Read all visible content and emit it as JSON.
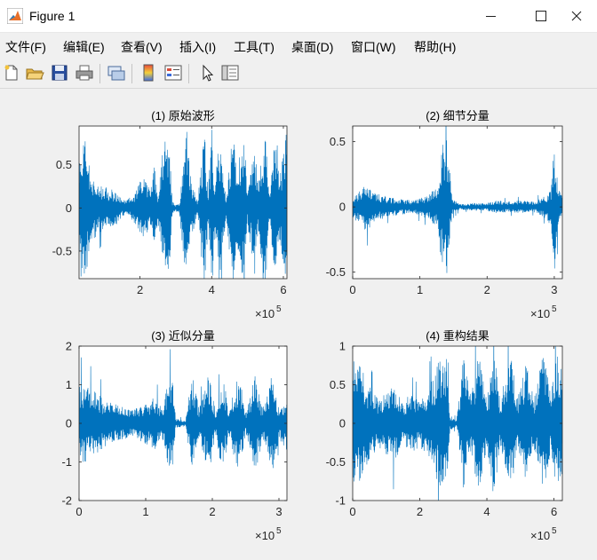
{
  "window": {
    "title": "Figure 1",
    "minimize_glyph": "—",
    "maximize_glyph": "☐",
    "close_glyph": "✕"
  },
  "menu": [
    {
      "label": "文件(F)"
    },
    {
      "label": "编辑(E)"
    },
    {
      "label": "查看(V)"
    },
    {
      "label": "插入(I)"
    },
    {
      "label": "工具(T)"
    },
    {
      "label": "桌面(D)"
    },
    {
      "label": "窗口(W)"
    },
    {
      "label": "帮助(H)"
    }
  ],
  "toolbar": {
    "icons": [
      "new-figure-icon",
      "open-file-icon",
      "save-icon",
      "print-icon",
      "link-plot-icon",
      "insert-colorbar-icon",
      "insert-legend-icon",
      "edit-plot-pointer-icon",
      "property-inspector-icon"
    ]
  },
  "colors": {
    "line": "#0072bd",
    "axes_bg": "#ffffff",
    "figure_bg": "#f0f0f0"
  },
  "chart_data": [
    {
      "type": "line",
      "title": "(1) 原始波形",
      "xlim": [
        30000,
        610000
      ],
      "ylim": [
        -0.82,
        0.95
      ],
      "xticks": [
        {
          "v": 200000,
          "label": "2"
        },
        {
          "v": 400000,
          "label": "4"
        },
        {
          "v": 600000,
          "label": "6"
        }
      ],
      "yticks": [
        {
          "v": 0.5,
          "label": "0.5"
        },
        {
          "v": 0,
          "label": "0"
        },
        {
          "v": -0.5,
          "label": "-0.5"
        }
      ],
      "x_exponent": "×10",
      "exp_power": "5",
      "envelope": [
        [
          30000,
          0.82
        ],
        [
          50000,
          0.78
        ],
        [
          60000,
          0.45
        ],
        [
          80000,
          0.32
        ],
        [
          100000,
          0.25
        ],
        [
          120000,
          0.22
        ],
        [
          140000,
          0.18
        ],
        [
          150000,
          0.1
        ],
        [
          160000,
          0.08
        ],
        [
          170000,
          0.12
        ],
        [
          180000,
          0.15
        ],
        [
          200000,
          0.3
        ],
        [
          210000,
          0.38
        ],
        [
          230000,
          0.2
        ],
        [
          240000,
          0.55
        ],
        [
          250000,
          0.12
        ],
        [
          270000,
          0.95
        ],
        [
          280000,
          0.95
        ],
        [
          290000,
          0.08
        ],
        [
          300000,
          0.04
        ],
        [
          310000,
          0.06
        ],
        [
          330000,
          0.95
        ],
        [
          340000,
          0.4
        ],
        [
          360000,
          0.08
        ],
        [
          380000,
          0.95
        ],
        [
          390000,
          0.2
        ],
        [
          400000,
          0.95
        ],
        [
          410000,
          0.3
        ],
        [
          420000,
          0.95
        ],
        [
          440000,
          0.12
        ],
        [
          460000,
          0.95
        ],
        [
          470000,
          0.4
        ],
        [
          490000,
          0.95
        ],
        [
          500000,
          0.2
        ],
        [
          520000,
          0.8
        ],
        [
          530000,
          0.3
        ],
        [
          550000,
          0.95
        ],
        [
          560000,
          0.15
        ],
        [
          580000,
          0.95
        ],
        [
          590000,
          0.35
        ],
        [
          610000,
          0.95
        ]
      ]
    },
    {
      "type": "line",
      "title": "(2) 细节分量",
      "xlim": [
        0,
        312000
      ],
      "ylim": [
        -0.55,
        0.62
      ],
      "xticks": [
        {
          "v": 0,
          "label": "0"
        },
        {
          "v": 100000,
          "label": "1"
        },
        {
          "v": 200000,
          "label": "2"
        },
        {
          "v": 300000,
          "label": "3"
        }
      ],
      "yticks": [
        {
          "v": 0.5,
          "label": "0.5"
        },
        {
          "v": 0,
          "label": "0"
        },
        {
          "v": -0.5,
          "label": "-0.5"
        }
      ],
      "x_exponent": "×10",
      "exp_power": "5",
      "envelope": [
        [
          0,
          0.1
        ],
        [
          10000,
          0.12
        ],
        [
          20000,
          0.2
        ],
        [
          30000,
          0.12
        ],
        [
          50000,
          0.08
        ],
        [
          70000,
          0.06
        ],
        [
          90000,
          0.05
        ],
        [
          110000,
          0.09
        ],
        [
          125000,
          0.15
        ],
        [
          132000,
          0.45
        ],
        [
          138000,
          0.62
        ],
        [
          142000,
          0.45
        ],
        [
          148000,
          0.06
        ],
        [
          160000,
          0.02
        ],
        [
          180000,
          0.03
        ],
        [
          200000,
          0.03
        ],
        [
          215000,
          0.05
        ],
        [
          230000,
          0.04
        ],
        [
          250000,
          0.05
        ],
        [
          270000,
          0.04
        ],
        [
          285000,
          0.08
        ],
        [
          295000,
          0.15
        ],
        [
          300000,
          0.5
        ],
        [
          305000,
          0.2
        ],
        [
          312000,
          0.08
        ]
      ]
    },
    {
      "type": "line",
      "title": "(3) 近似分量",
      "xlim": [
        0,
        312000
      ],
      "ylim": [
        -2,
        2
      ],
      "xticks": [
        {
          "v": 0,
          "label": "0"
        },
        {
          "v": 100000,
          "label": "1"
        },
        {
          "v": 200000,
          "label": "2"
        },
        {
          "v": 300000,
          "label": "3"
        }
      ],
      "yticks": [
        {
          "v": 2,
          "label": "2"
        },
        {
          "v": 1,
          "label": "1"
        },
        {
          "v": 0,
          "label": "0"
        },
        {
          "v": -1,
          "label": "-1"
        },
        {
          "v": -2,
          "label": "-2"
        }
      ],
      "x_exponent": "×10",
      "exp_power": "5",
      "envelope": [
        [
          0,
          1.1
        ],
        [
          20000,
          0.9
        ],
        [
          40000,
          0.6
        ],
        [
          60000,
          0.45
        ],
        [
          80000,
          0.35
        ],
        [
          100000,
          0.55
        ],
        [
          115000,
          0.7
        ],
        [
          125000,
          0.4
        ],
        [
          135000,
          1.2
        ],
        [
          140000,
          1.2
        ],
        [
          145000,
          0.12
        ],
        [
          160000,
          0.08
        ],
        [
          170000,
          1.3
        ],
        [
          180000,
          0.4
        ],
        [
          195000,
          1.3
        ],
        [
          205000,
          0.3
        ],
        [
          215000,
          1.3
        ],
        [
          225000,
          0.4
        ],
        [
          240000,
          1.3
        ],
        [
          250000,
          0.3
        ],
        [
          265000,
          1.3
        ],
        [
          275000,
          0.4
        ],
        [
          290000,
          1.3
        ],
        [
          300000,
          0.4
        ],
        [
          312000,
          0.7
        ]
      ]
    },
    {
      "type": "line",
      "title": "(4) 重构结果",
      "xlim": [
        0,
        625000
      ],
      "ylim": [
        -1,
        1
      ],
      "xticks": [
        {
          "v": 0,
          "label": "0"
        },
        {
          "v": 200000,
          "label": "2"
        },
        {
          "v": 400000,
          "label": "4"
        },
        {
          "v": 600000,
          "label": "6"
        }
      ],
      "yticks": [
        {
          "v": 1,
          "label": "1"
        },
        {
          "v": 0.5,
          "label": "0.5"
        },
        {
          "v": 0,
          "label": "0"
        },
        {
          "v": -0.5,
          "label": "-0.5"
        },
        {
          "v": -1,
          "label": "-1"
        }
      ],
      "x_exponent": "×10",
      "exp_power": "5",
      "envelope": [
        [
          0,
          0.85
        ],
        [
          20000,
          0.8
        ],
        [
          40000,
          0.55
        ],
        [
          60000,
          0.4
        ],
        [
          80000,
          0.32
        ],
        [
          100000,
          0.4
        ],
        [
          120000,
          0.55
        ],
        [
          150000,
          0.25
        ],
        [
          170000,
          0.4
        ],
        [
          200000,
          0.3
        ],
        [
          230000,
          0.5
        ],
        [
          260000,
          0.85
        ],
        [
          280000,
          0.85
        ],
        [
          290000,
          0.1
        ],
        [
          310000,
          0.05
        ],
        [
          330000,
          0.85
        ],
        [
          350000,
          0.4
        ],
        [
          380000,
          0.95
        ],
        [
          400000,
          0.3
        ],
        [
          420000,
          0.95
        ],
        [
          440000,
          0.3
        ],
        [
          470000,
          0.95
        ],
        [
          490000,
          0.3
        ],
        [
          520000,
          0.9
        ],
        [
          540000,
          0.3
        ],
        [
          570000,
          0.95
        ],
        [
          590000,
          0.4
        ],
        [
          610000,
          0.9
        ],
        [
          625000,
          0.7
        ]
      ]
    }
  ]
}
